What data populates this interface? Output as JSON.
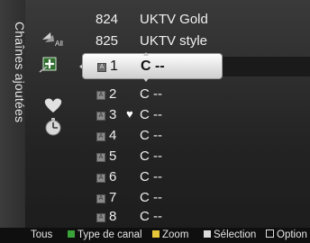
{
  "side_title": "Chaînes ajoutées",
  "modes": [
    {
      "icon": "all-channels-icon",
      "label": "All"
    },
    {
      "icon": "added-channels-icon",
      "label": ""
    },
    {
      "icon": "favorite-heart-icon",
      "label": ""
    },
    {
      "icon": "timer-clock-icon",
      "label": ""
    }
  ],
  "channels_top": [
    {
      "num": "824",
      "name": "UKTV Gold"
    },
    {
      "num": "825",
      "name": "UKTV style"
    }
  ],
  "added_channels": [
    {
      "badge": "A",
      "num": "1",
      "fav": "",
      "name": "C --"
    },
    {
      "badge": "A",
      "num": "2",
      "fav": "",
      "name": "C --"
    },
    {
      "badge": "A",
      "num": "3",
      "fav": "♥",
      "name": "C --"
    },
    {
      "badge": "A",
      "num": "4",
      "fav": "",
      "name": "C --"
    },
    {
      "badge": "A",
      "num": "5",
      "fav": "",
      "name": "C --"
    },
    {
      "badge": "A",
      "num": "6",
      "fav": "",
      "name": "C --"
    },
    {
      "badge": "A",
      "num": "7",
      "fav": "",
      "name": "C --"
    },
    {
      "badge": "A",
      "num": "8",
      "fav": "",
      "name": "C --"
    }
  ],
  "help_bar": {
    "tous": "Tous",
    "type": "Type de canal",
    "zoom": "Zoom",
    "selection": "Sélection",
    "option": "Option"
  },
  "colors": {
    "red": "#d23a3a",
    "green": "#3aa33a",
    "yellow": "#e6c73a",
    "blue": "#3a6fd2"
  }
}
